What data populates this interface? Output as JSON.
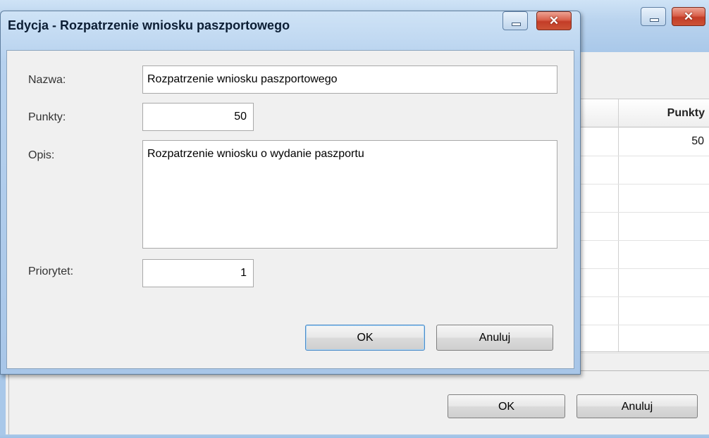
{
  "background_window": {
    "table": {
      "column_header": "Punkty",
      "rows": [
        "50",
        "",
        "",
        "",
        "",
        "",
        "",
        ""
      ]
    },
    "buttons": {
      "ok": "OK",
      "cancel": "Anuluj"
    },
    "close_glyph": "✕"
  },
  "dialog": {
    "title": "Edycja - Rozpatrzenie wniosku paszportowego",
    "close_glyph": "✕",
    "fields": {
      "name": {
        "label": "Nazwa:",
        "value": "Rozpatrzenie wniosku paszportowego"
      },
      "points": {
        "label": "Punkty:",
        "value": "50"
      },
      "desc": {
        "label": "Opis:",
        "value": "Rozpatrzenie wniosku o wydanie paszportu"
      },
      "priority": {
        "label": "Priorytet:",
        "value": "1"
      }
    },
    "buttons": {
      "ok": "OK",
      "cancel": "Anuluj"
    }
  },
  "colors": {
    "titlebar": "#b6d1ee",
    "client_bg": "#f0f0f0",
    "close_button": "#c33d27"
  },
  "icons": [
    "minimize-icon",
    "close-icon"
  ]
}
